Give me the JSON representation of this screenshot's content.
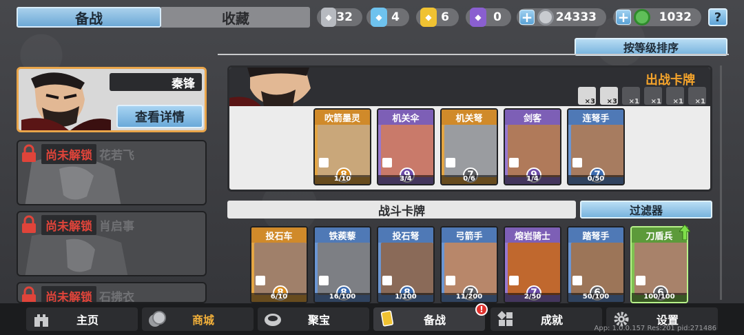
{
  "tabs": {
    "active": "备战",
    "inactive": "收藏"
  },
  "resources": [
    {
      "icon": "silver-shield-icon",
      "value": "32",
      "color": "#b7bac0"
    },
    {
      "icon": "blue-crystal-shield-icon",
      "value": "4",
      "color": "#6ec2ee"
    },
    {
      "icon": "gold-shield-icon",
      "value": "6",
      "color": "#f0c232"
    },
    {
      "icon": "purple-shield-icon",
      "value": "0",
      "color": "#8a5fd0"
    }
  ],
  "currency": [
    {
      "icon": "silver-coin-icon",
      "value": "24333",
      "color": "#c8cbd0"
    },
    {
      "icon": "jade-coin-icon",
      "value": "1032",
      "color": "#5fbf59"
    }
  ],
  "help_label": "?",
  "sort_label": "按等级排序",
  "heroes": {
    "selected": {
      "name": "秦锋",
      "detail_label": "查看详情"
    },
    "locked": [
      {
        "status": "尚未解锁",
        "name": "花若飞"
      },
      {
        "status": "尚未解锁",
        "name": "肖启事"
      },
      {
        "status": "尚未解锁",
        "name": "石拂衣"
      }
    ]
  },
  "deck": {
    "title": "出战卡牌",
    "type_counts": [
      "×3",
      "×3",
      "×1",
      "×1",
      "×1",
      "×1"
    ],
    "cards": [
      {
        "name": "吹箭墨灵",
        "level": "8",
        "count": "1/10",
        "rarity": "gold"
      },
      {
        "name": "机关伞",
        "level": "9",
        "count": "3/4",
        "rarity": "purple"
      },
      {
        "name": "机关弩",
        "level": "7",
        "count": "0/6",
        "rarity": "gold"
      },
      {
        "name": "剑客",
        "level": "9",
        "count": "1/4",
        "rarity": "purple"
      },
      {
        "name": "连弩手",
        "level": "7",
        "count": "0/50",
        "rarity": "blue"
      }
    ]
  },
  "battle_cards": {
    "title": "战斗卡牌",
    "filter_label": "过滤器",
    "cards": [
      {
        "name": "投石车",
        "level": "8",
        "count": "6/10",
        "rarity": "gold"
      },
      {
        "name": "铁蒺藜",
        "level": "8",
        "count": "16/100",
        "rarity": "blue"
      },
      {
        "name": "投石弩",
        "level": "8",
        "count": "1/100",
        "rarity": "blue"
      },
      {
        "name": "弓箭手",
        "level": "7",
        "count": "11/200",
        "rarity": "blue"
      },
      {
        "name": "熔岩骑士",
        "level": "7",
        "count": "2/50",
        "rarity": "purple"
      },
      {
        "name": "踏弩手",
        "level": "6",
        "count": "50/100",
        "rarity": "blue"
      },
      {
        "name": "刀盾兵",
        "level": "6",
        "count": "100/100",
        "rarity": "green"
      }
    ]
  },
  "nav": [
    {
      "label": "主页",
      "icon": "castle-icon"
    },
    {
      "label": "商城",
      "icon": "coins-icon"
    },
    {
      "label": "聚宝",
      "icon": "treasure-bowl-icon"
    },
    {
      "label": "备战",
      "icon": "cards-icon"
    },
    {
      "label": "成就",
      "icon": "achievement-grid-icon"
    },
    {
      "label": "设置",
      "icon": "gear-icon"
    }
  ],
  "badge": "!",
  "version": "App: 1.0.0.157 Res:201 pid:271486"
}
